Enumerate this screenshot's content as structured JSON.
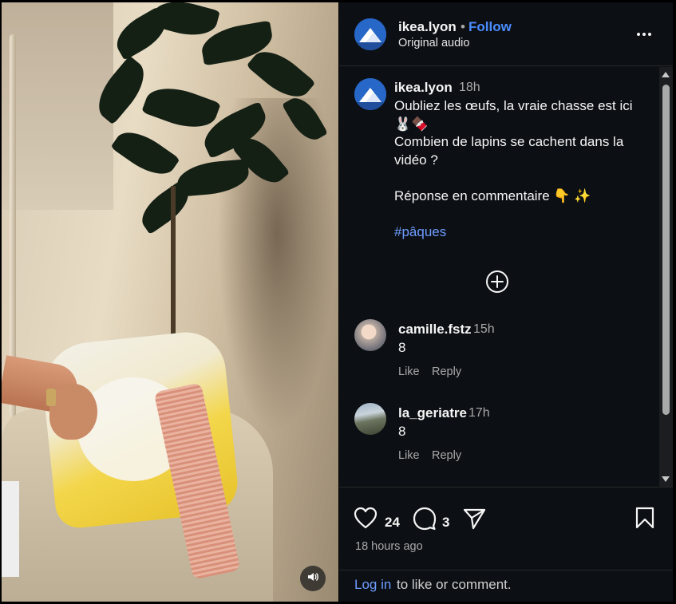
{
  "header": {
    "username": "ikea.lyon",
    "separator": "•",
    "follow_label": "Follow",
    "audio_label": "Original audio",
    "more_icon": "more-horizontal-icon"
  },
  "caption": {
    "username": "ikea.lyon",
    "time": "18h",
    "lines": [
      "Oubliez les œufs, la vraie chasse est ici",
      "🐰🍫",
      "Combien de lapins se cachent dans la",
      "vidéo ?",
      "",
      "Réponse en commentaire 👇 ✨",
      ""
    ],
    "hashtag": "#pâques"
  },
  "comments": [
    {
      "username": "camille.fstz",
      "time": "15h",
      "text": "8",
      "like_label": "Like",
      "reply_label": "Reply"
    },
    {
      "username": "la_geriatre",
      "time": "17h",
      "text": "8",
      "like_label": "Like",
      "reply_label": "Reply"
    }
  ],
  "actions": {
    "like_count": "24",
    "comment_count": "3",
    "posted": "18 hours ago"
  },
  "login": {
    "link": "Log in",
    "rest": "to like or comment."
  },
  "colors": {
    "panel_bg": "#0c1014",
    "link_blue": "#4a8cff",
    "muted_text": "#a8a8a8"
  }
}
